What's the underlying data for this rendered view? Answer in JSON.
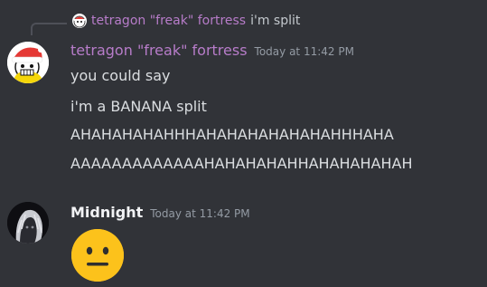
{
  "reply": {
    "author": "tetragon \"freak\" fortress",
    "text": "i'm split"
  },
  "messages": [
    {
      "author": "tetragon \"freak\" fortress",
      "timestamp": "Today at 11:42 PM",
      "lines": [
        "you could say",
        "i'm a BANANA split",
        "AHAHAHAHAHHHAHAHAHAHAHAHAHHHAHA",
        "AAAAAAAAAAAAAHAHAHAHAHHAHAHAHAHAH"
      ]
    },
    {
      "author": "Midnight",
      "timestamp": "Today at 11:42 PM",
      "emoji": "neutral-face"
    }
  ],
  "colors": {
    "background": "#313338",
    "tetragon_name": "#b77cc9",
    "midnight_name": "#f2f3f5",
    "timestamp": "#949ba4",
    "text": "#dbdee1"
  }
}
